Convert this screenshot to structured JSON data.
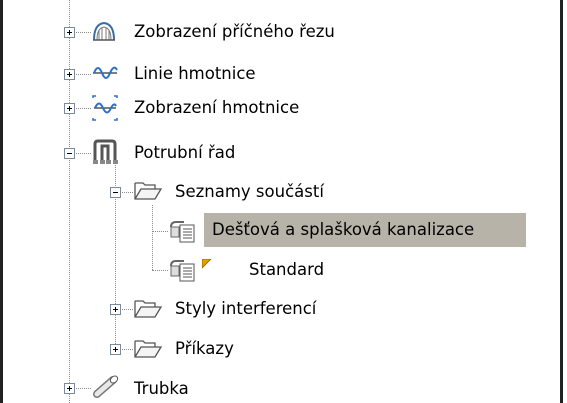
{
  "tree": {
    "items": [
      {
        "label": "Zobrazení příčného řezu",
        "icon": "cross-section-view-icon",
        "expander": "plus"
      },
      {
        "label": "Linie hmotnice",
        "icon": "mass-haul-line-icon",
        "expander": "plus"
      },
      {
        "label": "Zobrazení hmotnice",
        "icon": "mass-haul-view-icon",
        "expander": "plus"
      },
      {
        "label": "Potrubní řad",
        "icon": "pipe-network-icon",
        "expander": "minus"
      },
      {
        "label": "Seznamy součástí",
        "icon": "folder-open-icon",
        "expander": "minus"
      },
      {
        "label": "Dešťová a splašková kanalizace",
        "icon": "parts-list-icon",
        "selected": true
      },
      {
        "label": "Standard",
        "icon": "parts-list-icon",
        "flag": true
      },
      {
        "label": "Styly interferencí",
        "icon": "folder-open-icon",
        "expander": "plus"
      },
      {
        "label": "Příkazy",
        "icon": "folder-open-icon",
        "expander": "plus"
      },
      {
        "label": "Trubka",
        "icon": "pipe-icon",
        "expander": "plus"
      }
    ]
  },
  "colors": {
    "selection": "#b8b3a8",
    "dots": "#8c8c8c",
    "frame": "#222222",
    "flag": "#e0a000"
  }
}
